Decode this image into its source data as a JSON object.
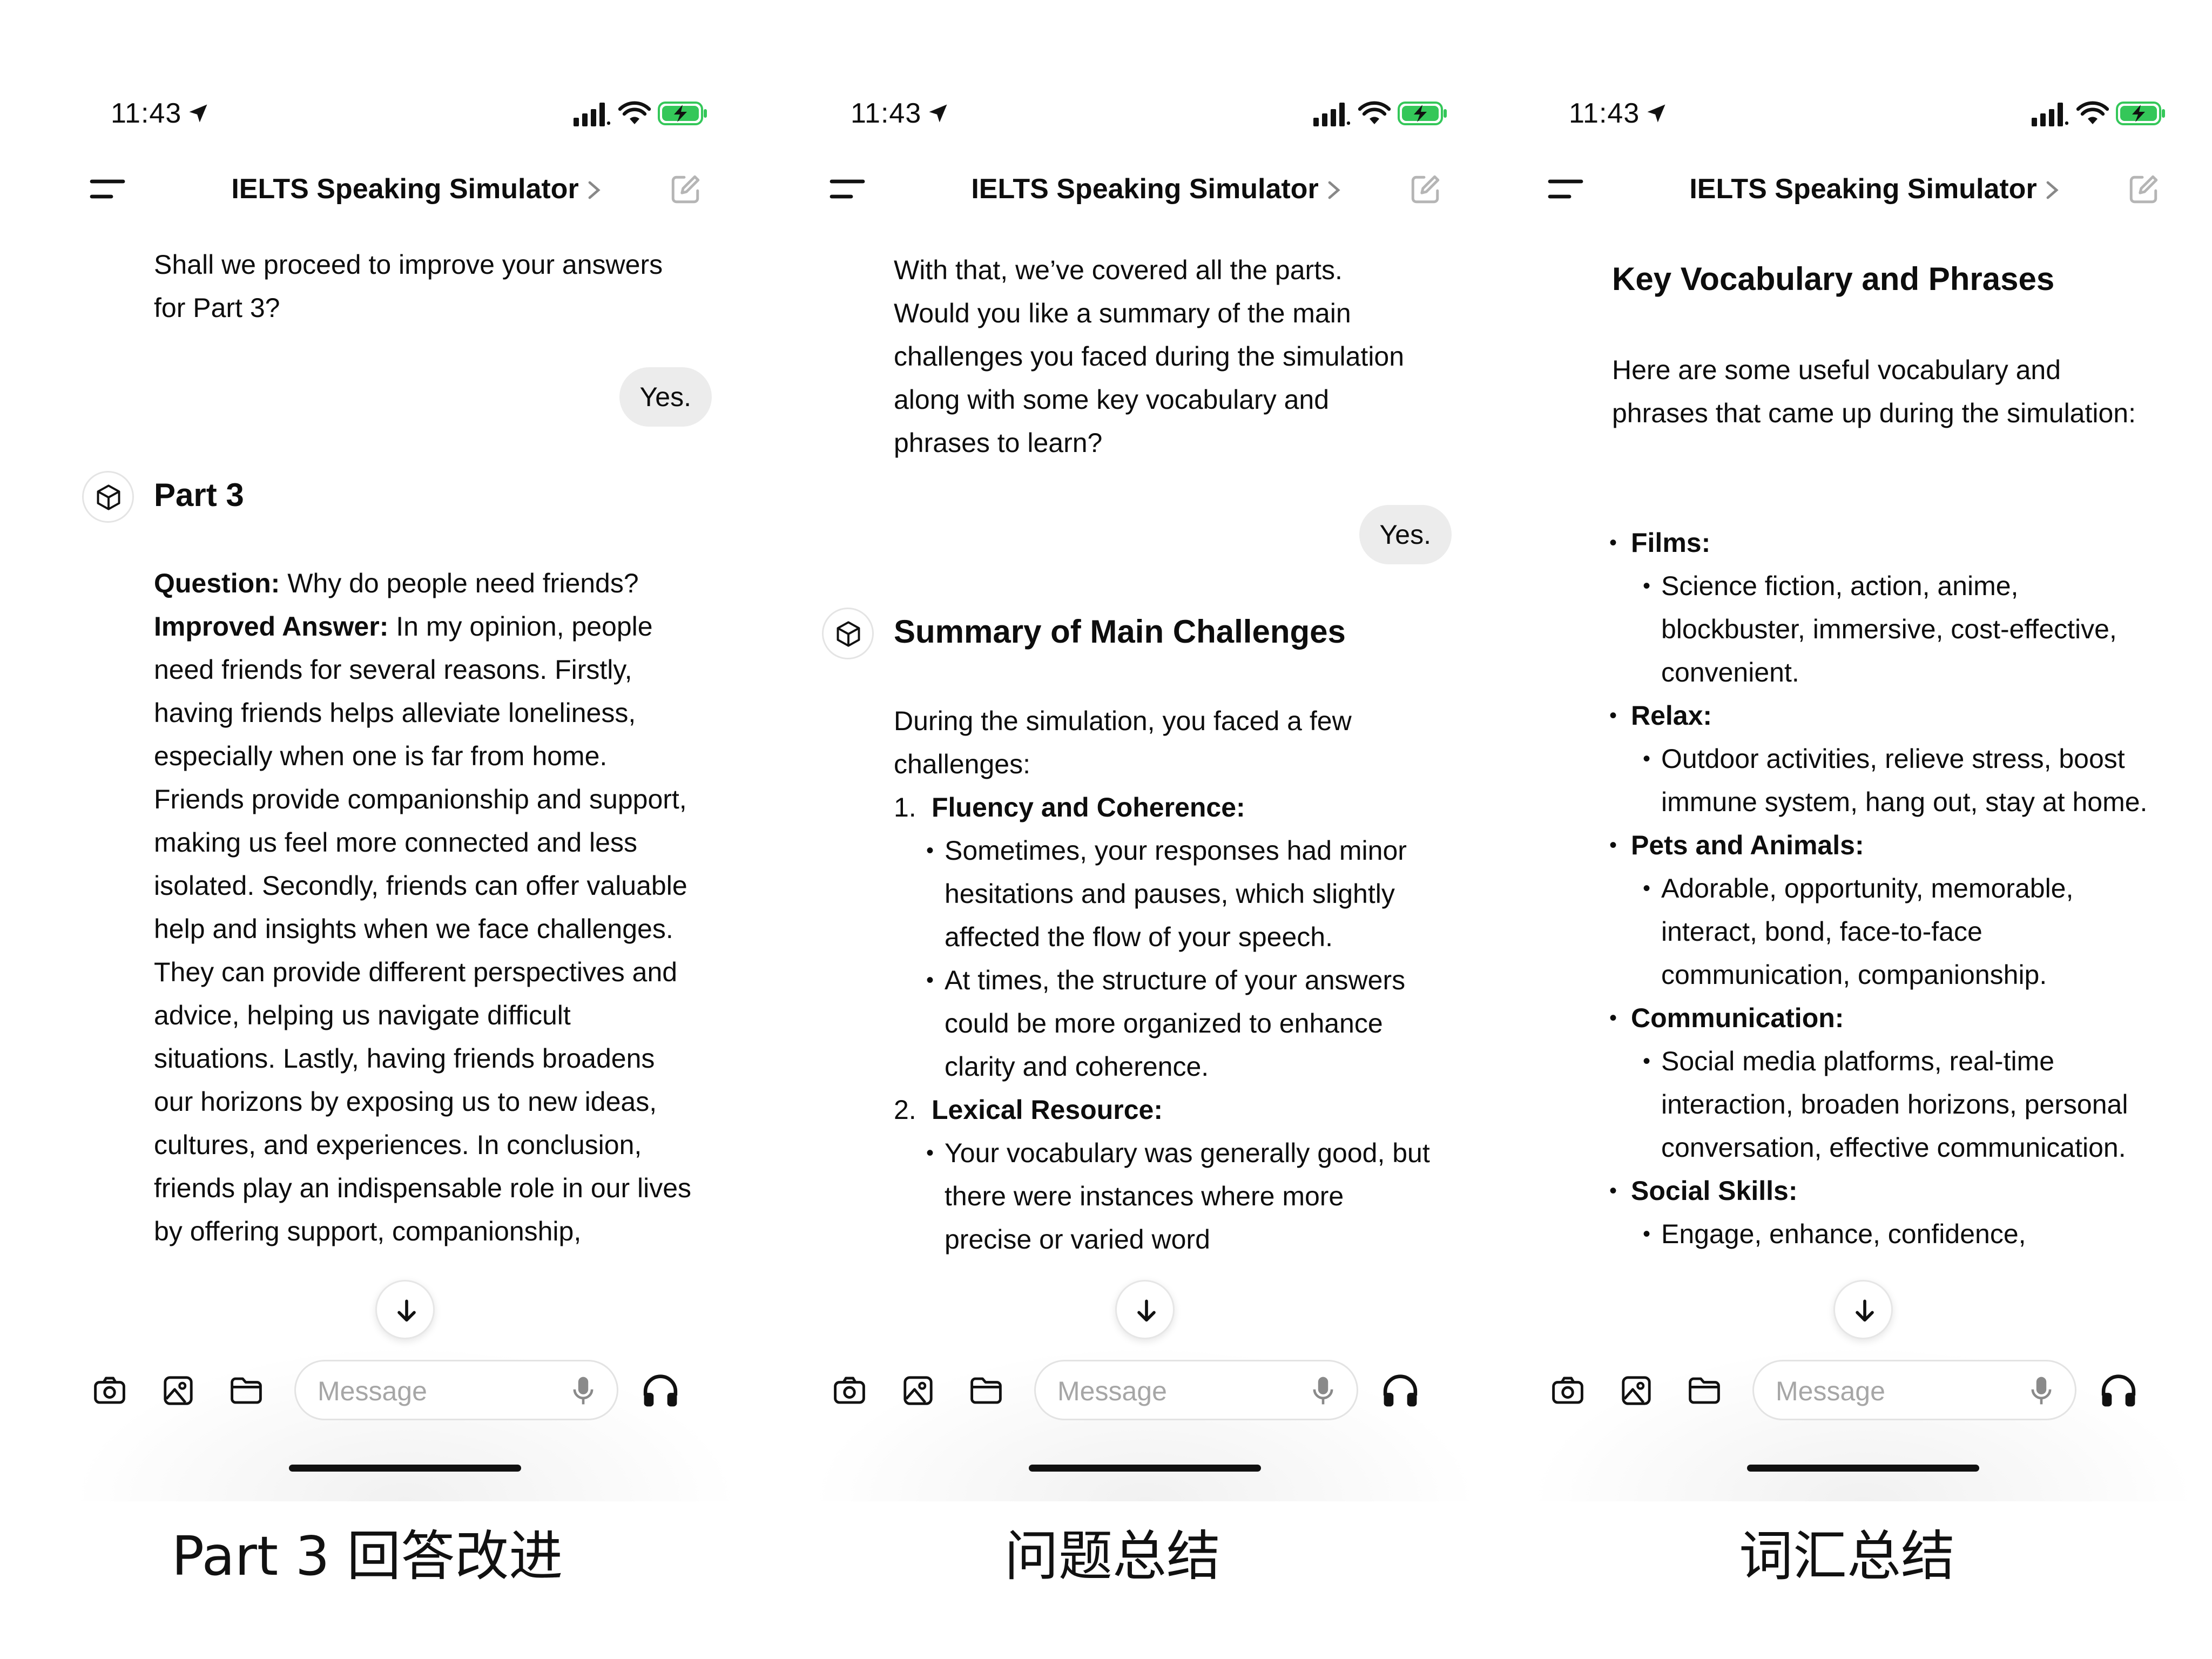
{
  "status_time": "11:43",
  "app_title": "IELTS Speaking Simulator",
  "composer": {
    "placeholder": "Message"
  },
  "screens": [
    {
      "prev_bot_text": "Shall we proceed to improve your answers for Part 3?",
      "user_reply": "Yes.",
      "heading": "Part 3",
      "question_label": "Question:",
      "question_text": "Why do people need friends?",
      "answer_label": "Improved Answer:",
      "answer_text": "In my opinion, people need friends for several reasons. Firstly, having friends helps alleviate loneliness, especially when one is far from home. Friends provide companionship and support, making us feel more connected and less isolated. Secondly, friends can offer valuable help and insights when we face challenges. They can provide different perspectives and advice, helping us navigate difficult situations. Lastly, having friends broadens our horizons by exposing us to new ideas, cultures, and experiences. In conclusion, friends play an indispensable role in our lives by offering support, companionship,"
    },
    {
      "prev_bot_text": "With that, we’ve covered all the parts. Would you like a summary of the main challenges you faced during the simulation along with some key vocabulary and phrases to learn?",
      "user_reply": "Yes.",
      "heading": "Summary of Main Challenges",
      "intro": "During the simulation, you faced a few challenges:",
      "items": [
        {
          "number": "1.",
          "title": "Fluency and Coherence:",
          "points": [
            "Sometimes, your responses had minor hesitations and pauses, which slightly affected the flow of your speech.",
            "At times, the structure of your answers could be more organized to enhance clarity and coherence."
          ]
        },
        {
          "number": "2.",
          "title": "Lexical Resource:",
          "points": [
            "Your vocabulary was generally good, but there were instances where more precise or varied word"
          ]
        }
      ]
    },
    {
      "heading": "Key Vocabulary and Phrases",
      "intro": "Here are some useful vocabulary and phrases that came up during the simulation:",
      "items": [
        {
          "title": "Films:",
          "points": [
            "Science fiction, action, anime, blockbuster, immersive, cost-effective, convenient."
          ]
        },
        {
          "title": "Relax:",
          "points": [
            "Outdoor activities, relieve stress, boost immune system, hang out, stay at home."
          ]
        },
        {
          "title": "Pets and Animals:",
          "points": [
            "Adorable, opportunity, memorable, interact, bond, face-to-face communication, companionship."
          ]
        },
        {
          "title": "Communication:",
          "points": [
            "Social media platforms, real-time interaction, broaden horizons, personal conversation, effective communication."
          ]
        },
        {
          "title": "Social Skills:",
          "points": [
            "Engage, enhance, confidence,"
          ]
        }
      ]
    }
  ],
  "captions": [
    "Part 3 回答改进",
    "问题总结",
    "词汇总结"
  ]
}
